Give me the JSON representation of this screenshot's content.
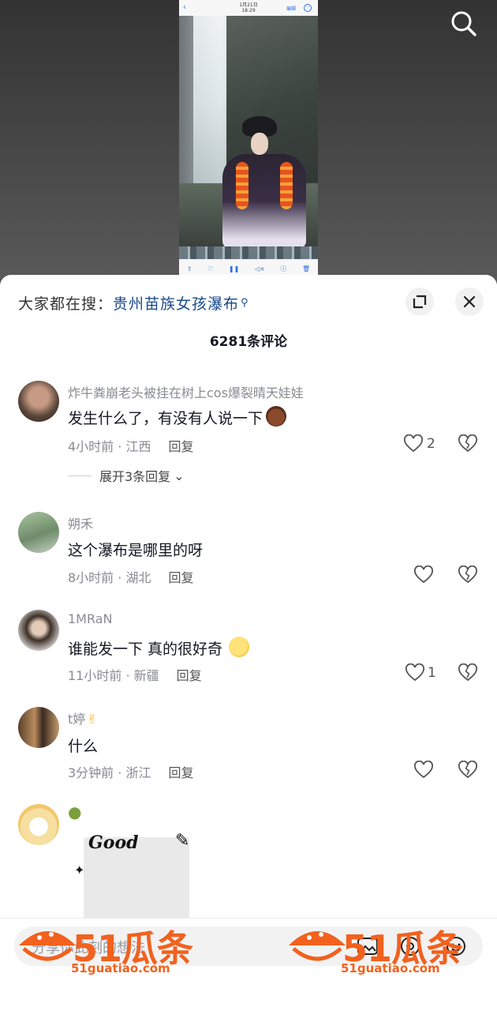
{
  "video": {
    "screenshot_date": "1月21日",
    "screenshot_time": "18:29",
    "screenshot_edit": "编辑"
  },
  "sheet": {
    "hot_search_prefix": "大家都在搜：",
    "hot_search_keyword": "贵州苗族女孩瀑布",
    "comment_count": "6281条评论"
  },
  "comments": [
    {
      "user": "炸牛粪崩老头被挂在树上cos爆裂晴天娃娃",
      "text": "发生什么了，有没有人说一下",
      "meta": "4小时前 · 江西",
      "reply": "回复",
      "likes": "2",
      "expand": "展开3条回复"
    },
    {
      "user": "朔禾",
      "text": "这个瀑布是哪里的呀",
      "meta": "8小时前 · 湖北",
      "reply": "回复",
      "likes": ""
    },
    {
      "user": "1MRaN",
      "text": "谁能发一下 真的很好奇",
      "meta": "11小时前 · 新疆",
      "reply": "回复",
      "likes": "1"
    },
    {
      "user": "t婷",
      "text": "什么",
      "meta": "3分钟前 · 浙江",
      "reply": "回复",
      "likes": ""
    },
    {
      "user": "",
      "sticker_text": "Good"
    }
  ],
  "input": {
    "placeholder": "分享你此刻的想法"
  },
  "watermark": {
    "brand": "51瓜条",
    "url": "51guatiao.com"
  },
  "colors": {
    "link_blue": "#1a4a8a",
    "watermark_orange": "#f2611d"
  }
}
